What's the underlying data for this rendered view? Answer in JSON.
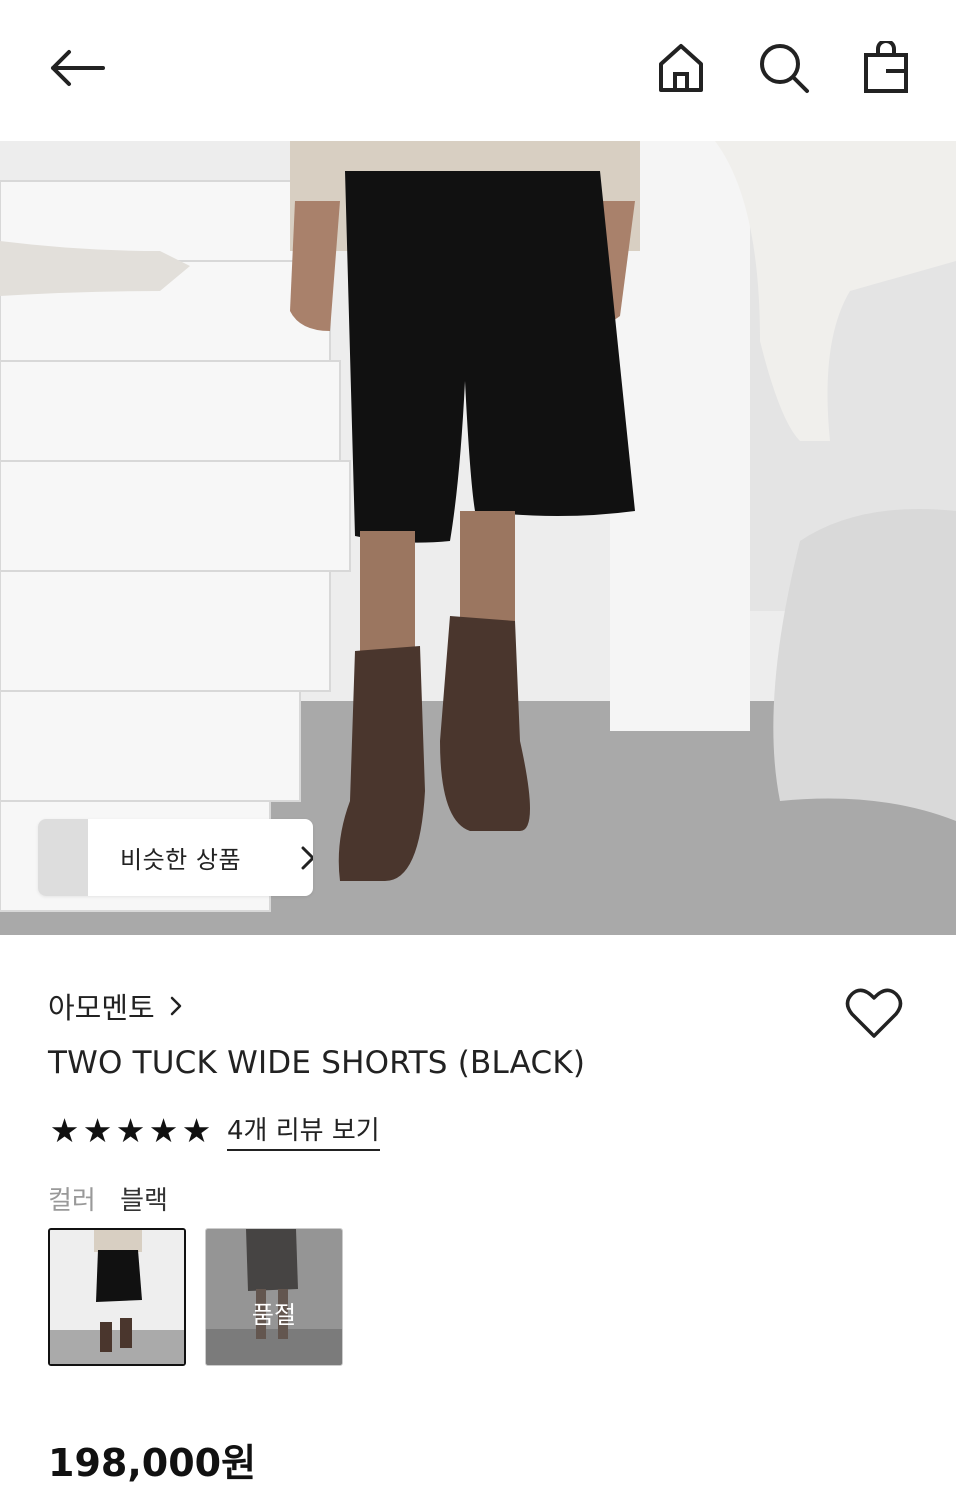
{
  "header": {
    "back_icon": "arrow-left-icon",
    "home_icon": "home-icon",
    "search_icon": "search-icon",
    "bag_icon": "shopping-bag-icon"
  },
  "hero": {
    "similar_products_label": "비슷한 상품"
  },
  "product": {
    "brand": "아모멘토",
    "title": "TWO TUCK WIDE SHORTS (BLACK)",
    "rating_stars": 5,
    "review_link": "4개 리뷰 보기",
    "color_label": "컬러",
    "color_value": "블랙",
    "swatches": [
      {
        "selected": true,
        "soldout": false
      },
      {
        "selected": false,
        "soldout": true,
        "soldout_label": "품절"
      }
    ],
    "price": "198,000원"
  },
  "colors": {
    "text": "#222222",
    "muted": "#999999",
    "background": "#ffffff"
  }
}
